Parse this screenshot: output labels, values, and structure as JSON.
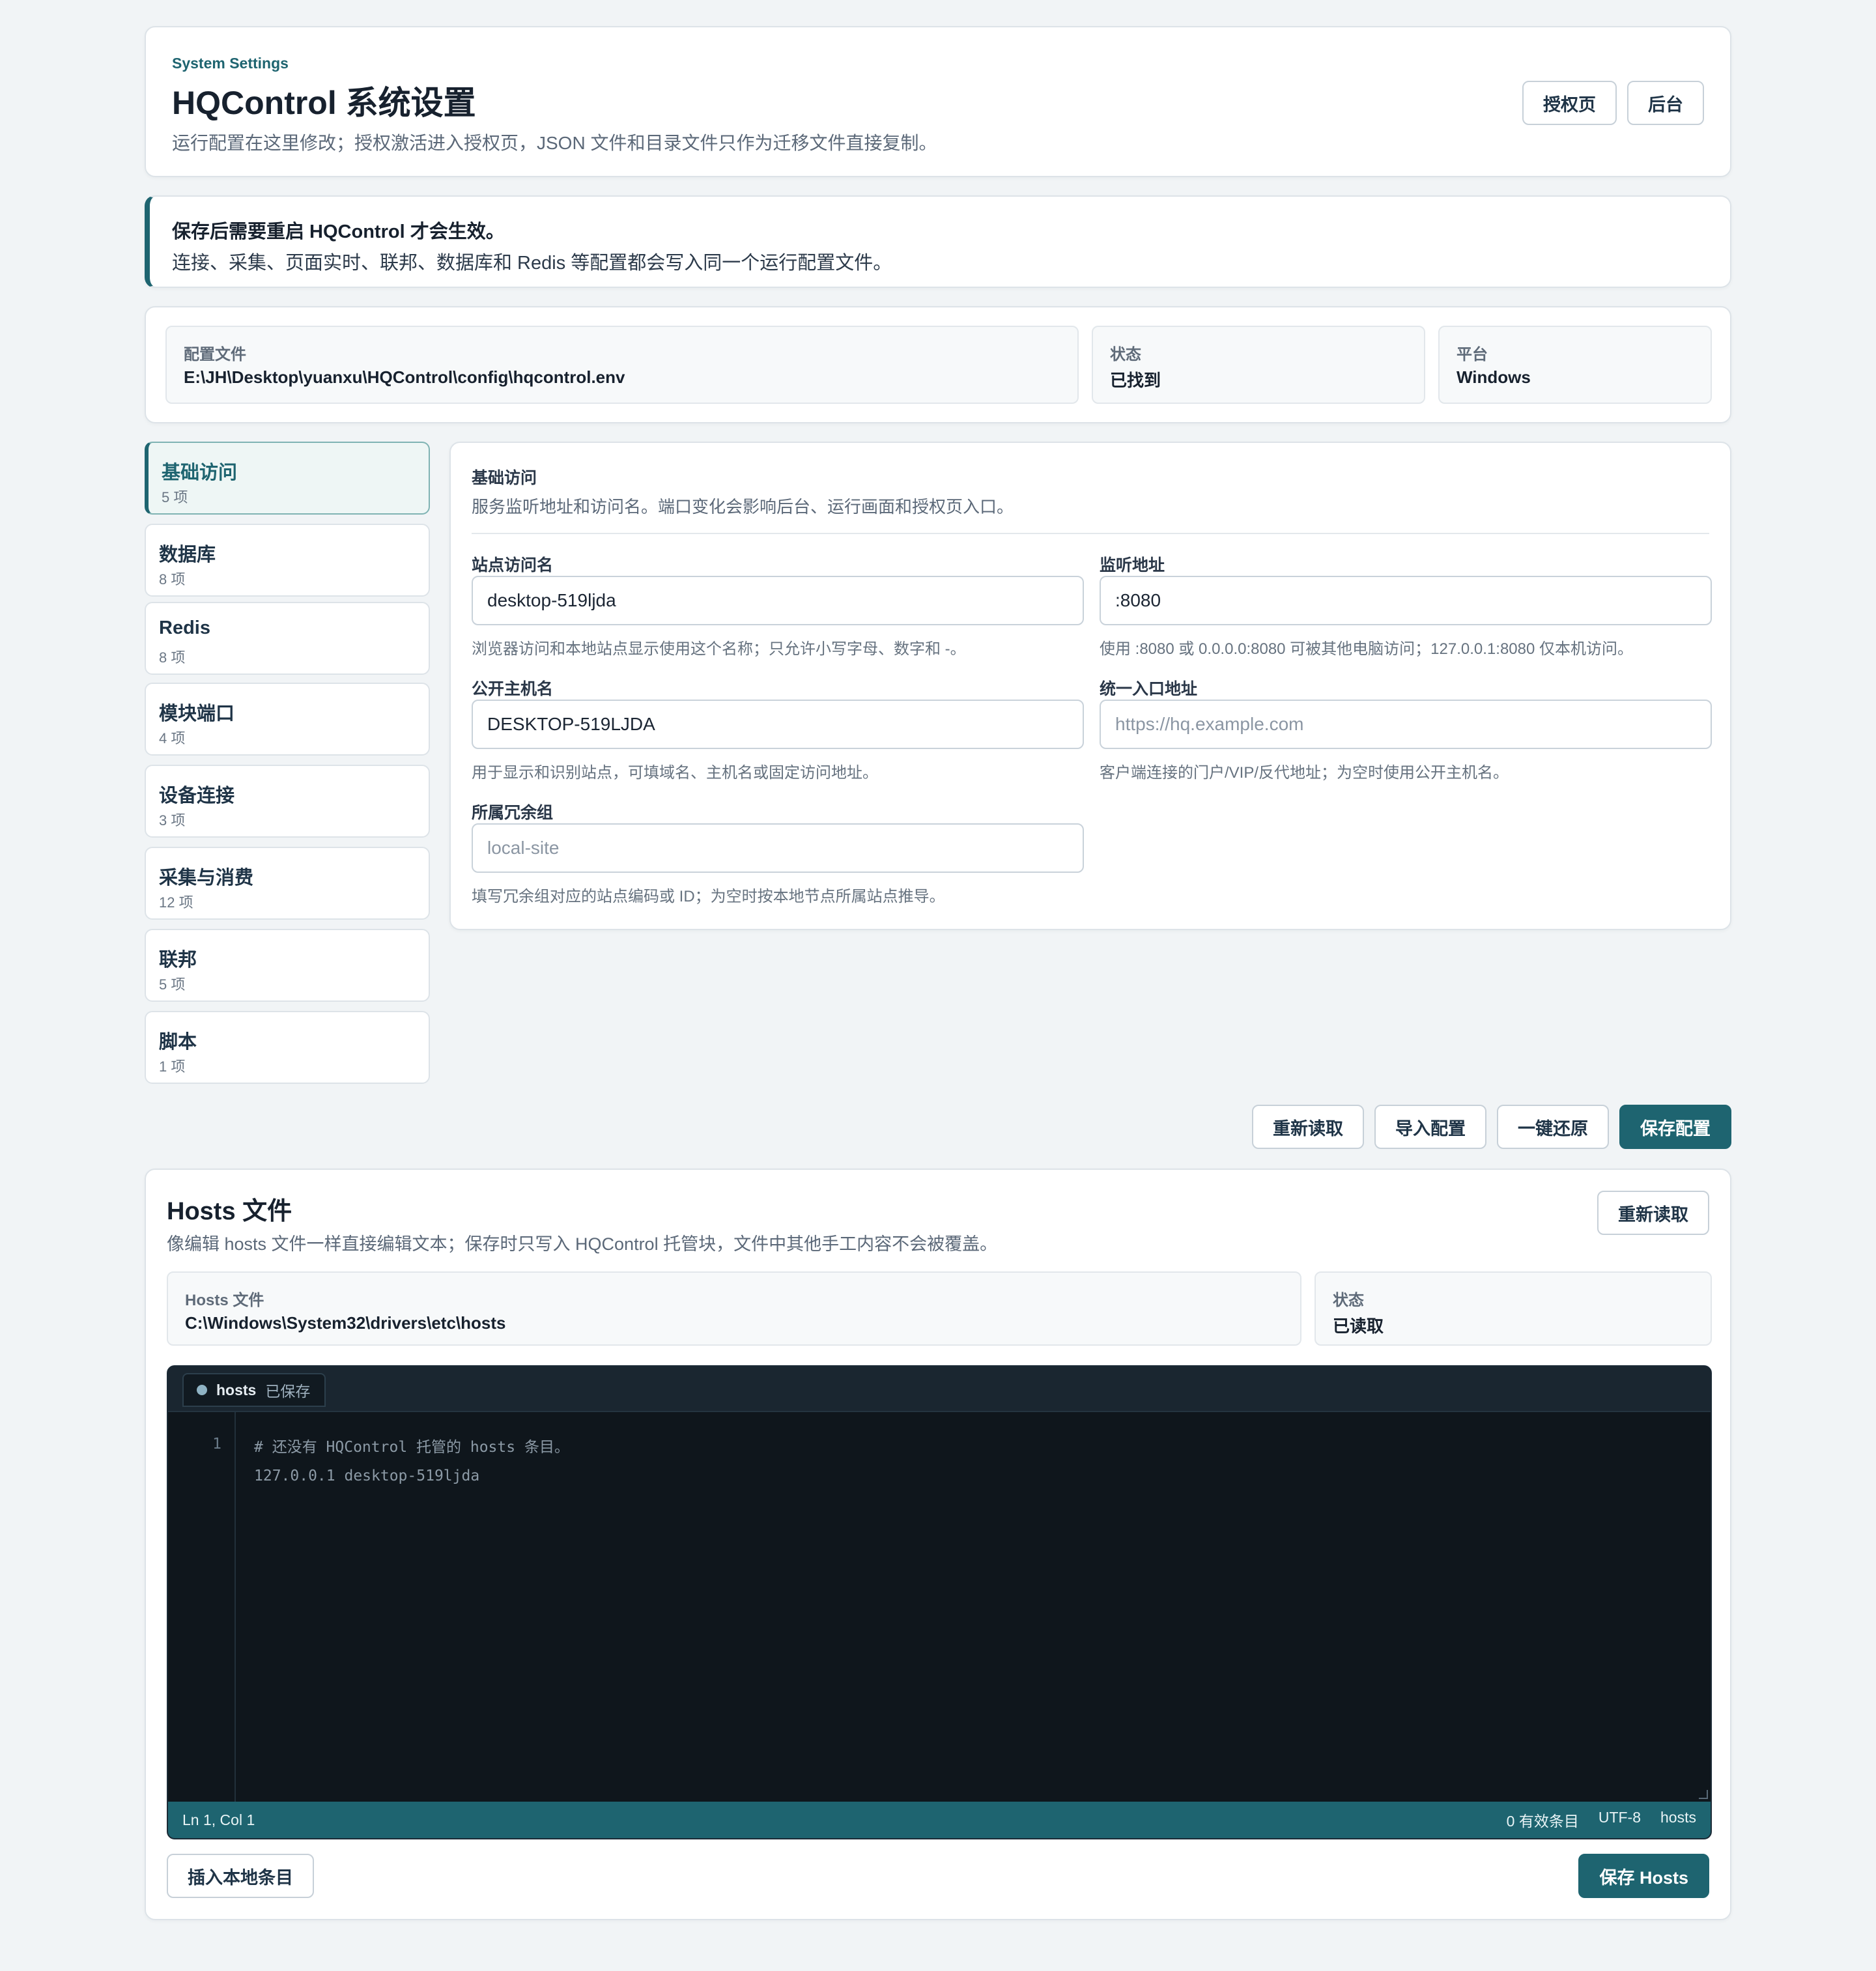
{
  "header": {
    "eyebrow": "System Settings",
    "title": "HQControl 系统设置",
    "subtitle": "运行配置在这里修改；授权激活进入授权页，JSON 文件和目录文件只作为迁移文件直接复制。",
    "buttons": {
      "license": "授权页",
      "admin": "后台"
    }
  },
  "notice": {
    "title": "保存后需要重启 HQControl 才会生效。",
    "body": "连接、采集、页面实时、联邦、数据库和 Redis 等配置都会写入同一个运行配置文件。"
  },
  "config_info": {
    "file": {
      "label": "配置文件",
      "value": "E:\\JH\\Desktop\\yuanxu\\HQControl\\config\\hqcontrol.env"
    },
    "status": {
      "label": "状态",
      "value": "已找到"
    },
    "platform": {
      "label": "平台",
      "value": "Windows"
    }
  },
  "sidebar": {
    "items": [
      {
        "label": "基础访问",
        "count": "5 项",
        "active": true
      },
      {
        "label": "数据库",
        "count": "8 项"
      },
      {
        "label": "Redis",
        "count": "8 项"
      },
      {
        "label": "模块端口",
        "count": "4 项"
      },
      {
        "label": "设备连接",
        "count": "3 项"
      },
      {
        "label": "采集与消费",
        "count": "12 项"
      },
      {
        "label": "联邦",
        "count": "5 项"
      },
      {
        "label": "脚本",
        "count": "1 项"
      }
    ]
  },
  "form": {
    "title": "基础访问",
    "description": "服务监听地址和访问名。端口变化会影响后台、运行画面和授权页入口。",
    "fields": {
      "site_name": {
        "label": "站点访问名",
        "value": "desktop-519ljda",
        "placeholder": "",
        "help": "浏览器访问和本地站点显示使用这个名称；只允许小写字母、数字和 -。"
      },
      "listen": {
        "label": "监听地址",
        "value": ":8080",
        "placeholder": "",
        "help": "使用 :8080 或 0.0.0.0:8080 可被其他电脑访问；127.0.0.1:8080 仅本机访问。"
      },
      "public_host": {
        "label": "公开主机名",
        "value": "DESKTOP-519LJDA",
        "placeholder": "",
        "help": "用于显示和识别站点，可填域名、主机名或固定访问地址。"
      },
      "entry_url": {
        "label": "统一入口地址",
        "value": "",
        "placeholder": "https://hq.example.com",
        "help": "客户端连接的门户/VIP/反代地址；为空时使用公开主机名。"
      },
      "redundancy_group": {
        "label": "所属冗余组",
        "value": "",
        "placeholder": "local-site",
        "help": "填写冗余组对应的站点编码或 ID；为空时按本地节点所属站点推导。"
      }
    }
  },
  "actions": {
    "reload": "重新读取",
    "import": "导入配置",
    "restore": "一键还原",
    "save": "保存配置"
  },
  "hosts": {
    "title": "Hosts 文件",
    "description": "像编辑 hosts 文件一样直接编辑文本；保存时只写入 HQControl 托管块，文件中其他手工内容不会被覆盖。",
    "reload": "重新读取",
    "file": {
      "label": "Hosts 文件",
      "value": "C:\\Windows\\System32\\drivers\\etc\\hosts"
    },
    "status": {
      "label": "状态",
      "value": "已读取"
    },
    "editor": {
      "tab_name": "hosts",
      "tab_state": "已保存",
      "line_numbers": "1",
      "code": "# 还没有 HQControl 托管的 hosts 条目。\n127.0.0.1 desktop-519ljda",
      "status_left": "Ln 1, Col 1",
      "status_entries": "0 有效条目",
      "status_encoding": "UTF-8",
      "status_lang": "hosts"
    },
    "insert_local": "插入本地条目",
    "save": "保存 Hosts"
  }
}
